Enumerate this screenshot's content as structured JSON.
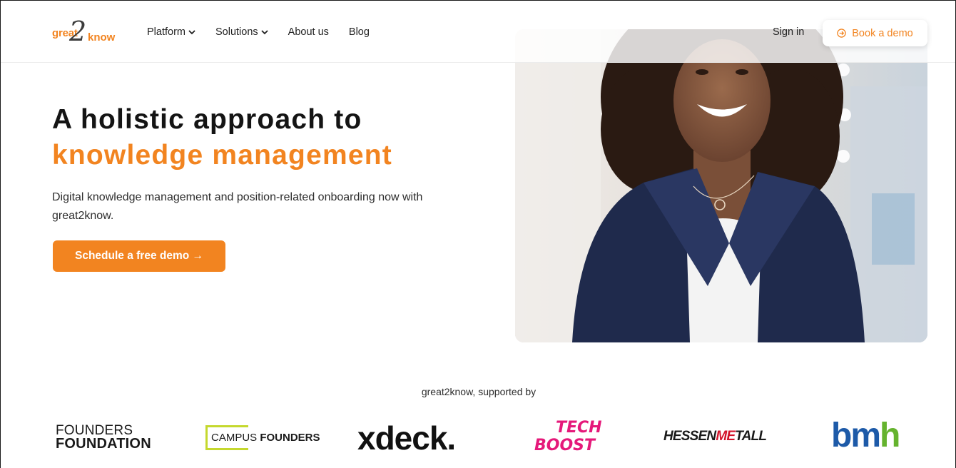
{
  "nav": {
    "logo": {
      "left": "great",
      "mid": "2",
      "right": "know"
    },
    "links": [
      {
        "label": "Platform",
        "dropdown": true
      },
      {
        "label": "Solutions",
        "dropdown": true
      },
      {
        "label": "About us",
        "dropdown": false
      },
      {
        "label": "Blog",
        "dropdown": false
      }
    ],
    "signin": "Sign in",
    "book_demo": "Book a demo"
  },
  "hero": {
    "headline_line1": "A holistic approach to",
    "headline_line2": "knowledge management",
    "subtext": "Digital knowledge management and position-related onboarding now with great2know.",
    "cta": "Schedule a free demo →"
  },
  "supporters": {
    "heading": "great2know, supported by",
    "logos": [
      {
        "line1": "FOUNDERS",
        "line2": "FOUNDATION"
      },
      {
        "light": "CAMPUS ",
        "bold": "FOUNDERS"
      },
      {
        "text": "xdeck."
      },
      {
        "line1": "TECH",
        "line2": "BOOST"
      },
      {
        "a": "HESSEN",
        "b": "ME",
        "c": "TALL"
      },
      {
        "a": "b",
        "b": "m",
        "c": "h"
      }
    ]
  },
  "colors": {
    "accent": "#f28420",
    "text": "#141414"
  }
}
